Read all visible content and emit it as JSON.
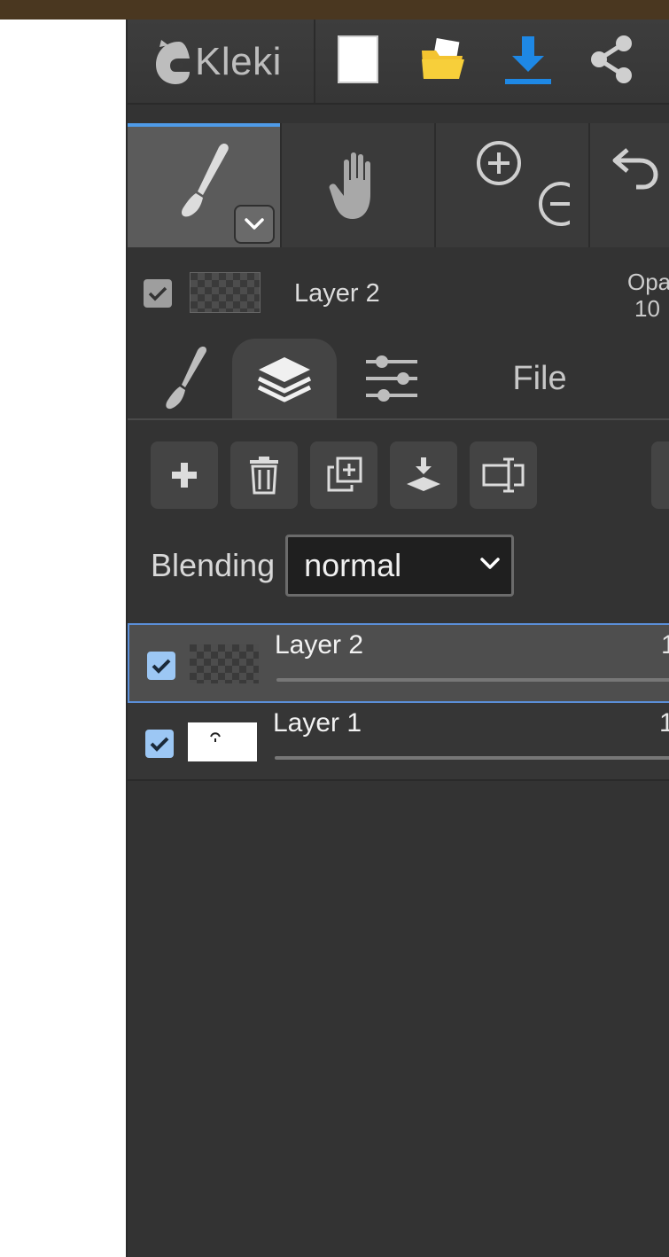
{
  "app": {
    "logo_text": "Kleki"
  },
  "colors": {
    "accent": "#4f9be8",
    "download": "#1e88e5",
    "folder": "#f4c430",
    "panel_bg": "#333333",
    "top_strip": "#4a3720"
  },
  "header": {
    "buttons": [
      {
        "name": "new-image",
        "icon": "blank-page-icon"
      },
      {
        "name": "open",
        "icon": "folder-icon"
      },
      {
        "name": "save",
        "icon": "download-icon"
      },
      {
        "name": "share",
        "icon": "share-icon"
      }
    ]
  },
  "tools": {
    "active": "brush",
    "items": [
      "brush",
      "hand",
      "zoom",
      "undo"
    ]
  },
  "current_layer": {
    "name": "Layer 2",
    "opacity_label": "Opa",
    "opacity_value": "10"
  },
  "tabs": {
    "active": "layers",
    "items": [
      {
        "id": "brush",
        "icon": "brush-icon"
      },
      {
        "id": "layers",
        "icon": "layers-icon"
      },
      {
        "id": "adjust",
        "icon": "sliders-icon"
      },
      {
        "id": "file",
        "label": "File"
      }
    ]
  },
  "layer_actions": [
    "add-layer",
    "delete-layer",
    "duplicate-layer",
    "merge-down",
    "rename-layer"
  ],
  "blending": {
    "label": "Blending",
    "value": "normal"
  },
  "layers": [
    {
      "name": "Layer 2",
      "value": "1",
      "visible": true,
      "active": true
    },
    {
      "name": "Layer 1",
      "value": "1",
      "visible": true,
      "active": false
    }
  ]
}
